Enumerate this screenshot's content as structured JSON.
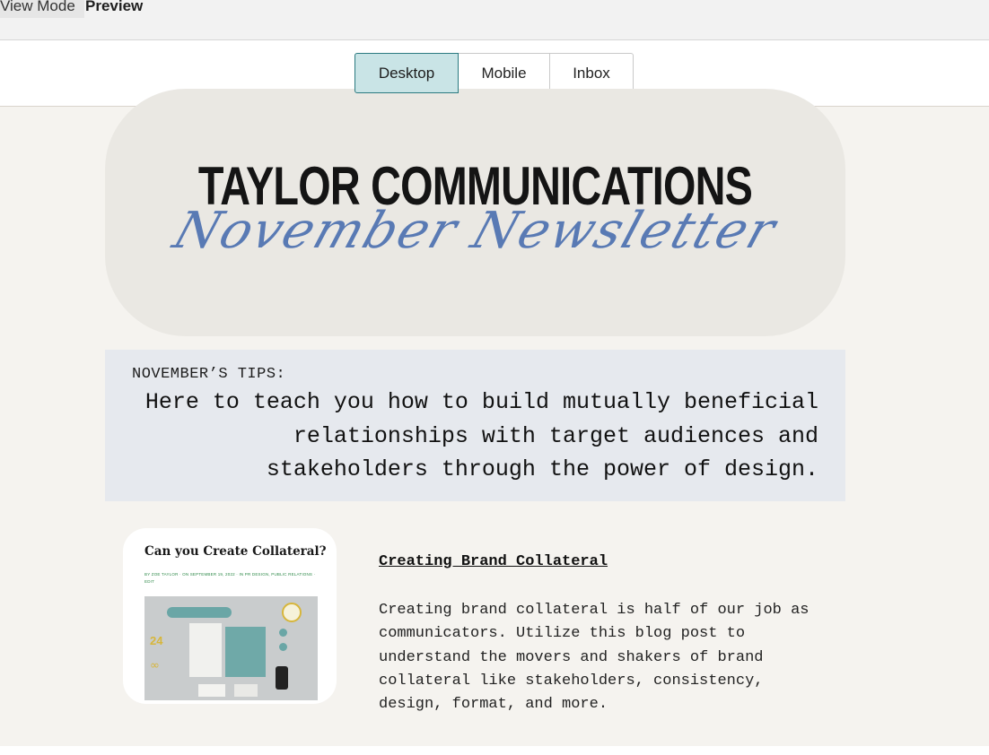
{
  "modebar": {
    "view_mode_label": "View Mode",
    "preview_label": "Preview"
  },
  "device_toggle": {
    "options": [
      "Desktop",
      "Mobile",
      "Inbox"
    ],
    "active": "Desktop"
  },
  "email": {
    "brand_title": "TAYLOR COMMUNICATIONS",
    "brand_subtitle": "November Newsletter",
    "tips_label": "NOVEMBER’S TIPS:",
    "tips_text": "Here to teach you how to build mutually beneficial relationships with target audiences and stakeholders through the power of design.",
    "article": {
      "thumbnail_title": "Can you Create Collateral?",
      "thumbnail_meta": "BY ZOE TAYLOR · ON SEPTEMBER 19, 2022 · IN PR DESIGN, PUBLIC RELATIONS · EDIT",
      "thumbnail_number": "24",
      "title": "Creating Brand Collateral",
      "body": "Creating brand collateral is half of our job as communicators. Utilize this blog post to understand the movers and shakers of brand collateral like stakeholders, consistency, design, format, and more."
    }
  },
  "colors": {
    "active_toggle_bg": "#c9e4e6",
    "active_toggle_border": "#2b7a80",
    "canvas_bg": "#f5f3ef",
    "banner_bg": "#eae8e3",
    "tips_bg": "#e6e9ee",
    "script_blue": "#4a6fb0"
  },
  "icons": {
    "thumbnail_infinity": "∞"
  }
}
